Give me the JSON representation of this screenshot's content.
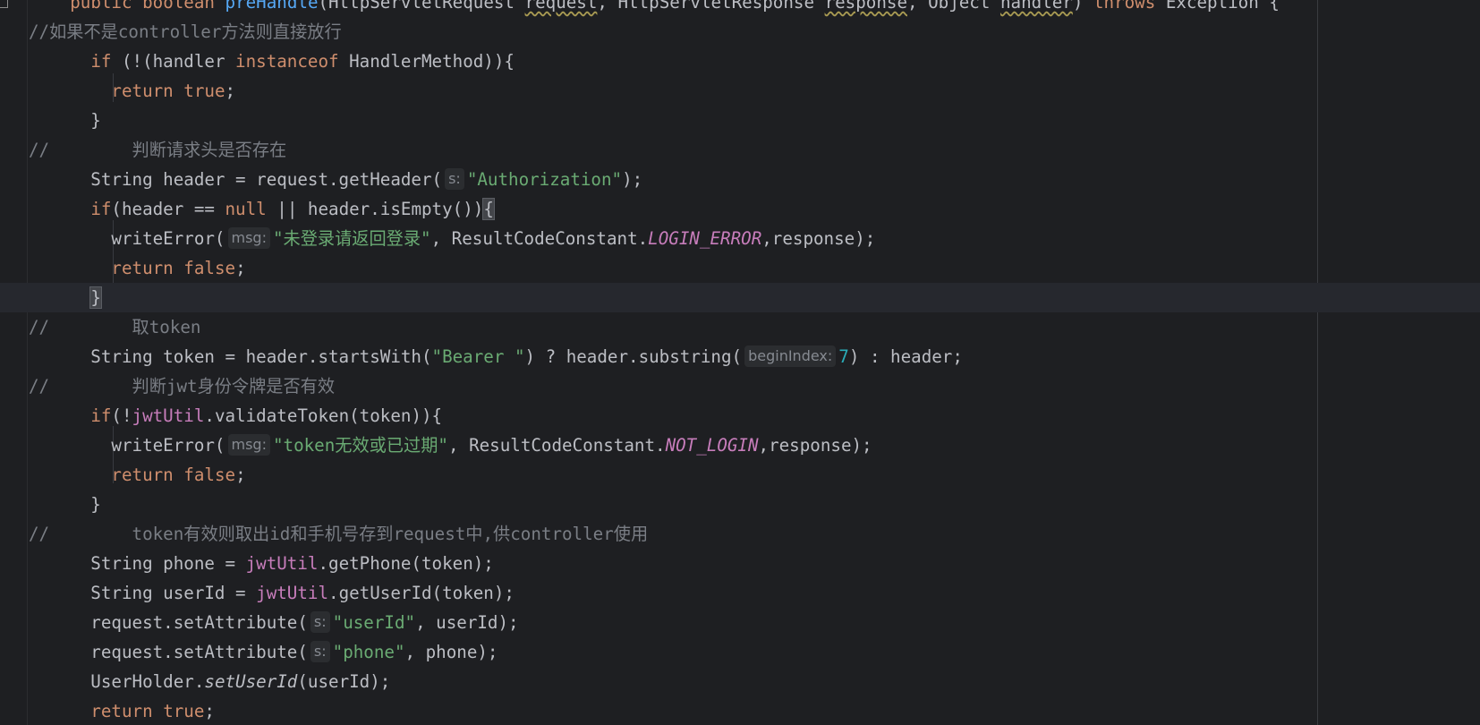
{
  "editor": {
    "language": "Java",
    "lines": [
      {
        "name": "method-signature-line",
        "tokens": [
          {
            "t": "    "
          },
          {
            "t": "public",
            "c": "kw"
          },
          {
            "t": " "
          },
          {
            "t": "boolean",
            "c": "kw"
          },
          {
            "t": " "
          },
          {
            "t": "preHandle",
            "c": "fn"
          },
          {
            "t": "(HttpServletRequest "
          },
          {
            "t": "request",
            "c": "warn"
          },
          {
            "t": ", HttpServletResponse "
          },
          {
            "t": "response",
            "c": "warn"
          },
          {
            "t": ", Object "
          },
          {
            "t": "handler",
            "c": "warn"
          },
          {
            "t": ") "
          },
          {
            "t": "throws",
            "c": "kw"
          },
          {
            "t": " Exception {"
          }
        ]
      },
      {
        "name": "comment-line",
        "tokens": [
          {
            "t": "//如果不是controller方法则直接放行",
            "c": "cmt"
          }
        ]
      },
      {
        "name": "if-handler-line",
        "tokens": [
          {
            "t": "      "
          },
          {
            "t": "if",
            "c": "kw"
          },
          {
            "t": " (!(handler "
          },
          {
            "t": "instanceof",
            "c": "kw"
          },
          {
            "t": " HandlerMethod)){"
          }
        ]
      },
      {
        "name": "return-true-line",
        "tokens": [
          {
            "t": "        "
          },
          {
            "t": "return",
            "c": "kw"
          },
          {
            "t": " "
          },
          {
            "t": "true",
            "c": "kw"
          },
          {
            "t": ";"
          }
        ]
      },
      {
        "name": "closing-brace-line",
        "tokens": [
          {
            "t": "      }"
          }
        ]
      },
      {
        "name": "comment-line",
        "tokens": [
          {
            "t": "//",
            "c": "cmt"
          },
          {
            "t": "        判断请求头是否存在",
            "c": "cmt"
          }
        ]
      },
      {
        "name": "header-declaration-line",
        "tokens": [
          {
            "t": "      String header = request.getHeader("
          },
          {
            "hint": "s:"
          },
          {
            "t": "\"Authorization\"",
            "c": "str"
          },
          {
            "t": ");"
          }
        ]
      },
      {
        "name": "if-header-null-line",
        "tokens": [
          {
            "t": "      "
          },
          {
            "t": "if",
            "c": "kw"
          },
          {
            "t": "(header == "
          },
          {
            "t": "null",
            "c": "kw"
          },
          {
            "t": " || header.isEmpty())"
          },
          {
            "t": "{",
            "c": "brace-match"
          }
        ]
      },
      {
        "name": "write-error-line",
        "tokens": [
          {
            "t": "        writeError("
          },
          {
            "hint": "msg:"
          },
          {
            "t": "\"未登录请返回登录\"",
            "c": "str"
          },
          {
            "t": ", ResultCodeConstant."
          },
          {
            "t": "LOGIN_ERROR",
            "c": "static"
          },
          {
            "t": ",response);"
          }
        ]
      },
      {
        "name": "return-false-line",
        "tokens": [
          {
            "t": "        "
          },
          {
            "t": "return",
            "c": "kw"
          },
          {
            "t": " "
          },
          {
            "t": "false",
            "c": "kw"
          },
          {
            "t": ";"
          }
        ]
      },
      {
        "name": "closing-brace-line",
        "current": true,
        "tokens": [
          {
            "t": "      "
          },
          {
            "t": "}",
            "c": "brace-match"
          }
        ]
      },
      {
        "name": "comment-line",
        "tokens": [
          {
            "t": "//",
            "c": "cmt"
          },
          {
            "t": "        取token",
            "c": "cmt"
          }
        ]
      },
      {
        "name": "token-declaration-line",
        "tokens": [
          {
            "t": "      String token = header.startsWith("
          },
          {
            "t": "\"Bearer \"",
            "c": "str"
          },
          {
            "t": ") ? header.substring("
          },
          {
            "hint": "beginIndex:"
          },
          {
            "t": "7",
            "c": "num"
          },
          {
            "t": ") : header;"
          }
        ]
      },
      {
        "name": "comment-line",
        "tokens": [
          {
            "t": "//",
            "c": "cmt"
          },
          {
            "t": "        判断jwt身份令牌是否有效",
            "c": "cmt"
          }
        ]
      },
      {
        "name": "if-validate-line",
        "tokens": [
          {
            "t": "      "
          },
          {
            "t": "if",
            "c": "kw"
          },
          {
            "t": "(!"
          },
          {
            "t": "jwtUtil",
            "c": "field"
          },
          {
            "t": ".validateToken(token)){"
          }
        ]
      },
      {
        "name": "write-error-line",
        "tokens": [
          {
            "t": "        writeError("
          },
          {
            "hint": "msg:"
          },
          {
            "t": "\"token无效或已过期\"",
            "c": "str"
          },
          {
            "t": ", ResultCodeConstant."
          },
          {
            "t": "NOT_LOGIN",
            "c": "static"
          },
          {
            "t": ",response);"
          }
        ]
      },
      {
        "name": "return-false-line",
        "tokens": [
          {
            "t": "        "
          },
          {
            "t": "return",
            "c": "kw"
          },
          {
            "t": " "
          },
          {
            "t": "false",
            "c": "kw"
          },
          {
            "t": ";"
          }
        ]
      },
      {
        "name": "closing-brace-line",
        "tokens": [
          {
            "t": "      }"
          }
        ]
      },
      {
        "name": "comment-line",
        "tokens": [
          {
            "t": "//",
            "c": "cmt"
          },
          {
            "t": "        token有效则取出id和手机号存到request中,供controller使用",
            "c": "cmt"
          }
        ]
      },
      {
        "name": "phone-declaration-line",
        "tokens": [
          {
            "t": "      String phone = "
          },
          {
            "t": "jwtUtil",
            "c": "field"
          },
          {
            "t": ".getPhone(token);"
          }
        ]
      },
      {
        "name": "userid-declaration-line",
        "tokens": [
          {
            "t": "      String userId = "
          },
          {
            "t": "jwtUtil",
            "c": "field"
          },
          {
            "t": ".getUserId(token);"
          }
        ]
      },
      {
        "name": "set-attribute-line",
        "tokens": [
          {
            "t": "      request.setAttribute("
          },
          {
            "hint": "s:"
          },
          {
            "t": "\"userId\"",
            "c": "str"
          },
          {
            "t": ", userId);"
          }
        ]
      },
      {
        "name": "set-attribute-line",
        "tokens": [
          {
            "t": "      request.setAttribute("
          },
          {
            "hint": "s:"
          },
          {
            "t": "\"phone\"",
            "c": "str"
          },
          {
            "t": ", phone);"
          }
        ]
      },
      {
        "name": "set-user-id-line",
        "tokens": [
          {
            "t": "      UserHolder."
          },
          {
            "t": "setUserId",
            "c": "ital"
          },
          {
            "t": "(userId);"
          }
        ]
      },
      {
        "name": "return-true-line",
        "tokens": [
          {
            "t": "      "
          },
          {
            "t": "return",
            "c": "kw"
          },
          {
            "t": " "
          },
          {
            "t": "true",
            "c": "kw"
          },
          {
            "t": ";"
          }
        ]
      }
    ]
  }
}
